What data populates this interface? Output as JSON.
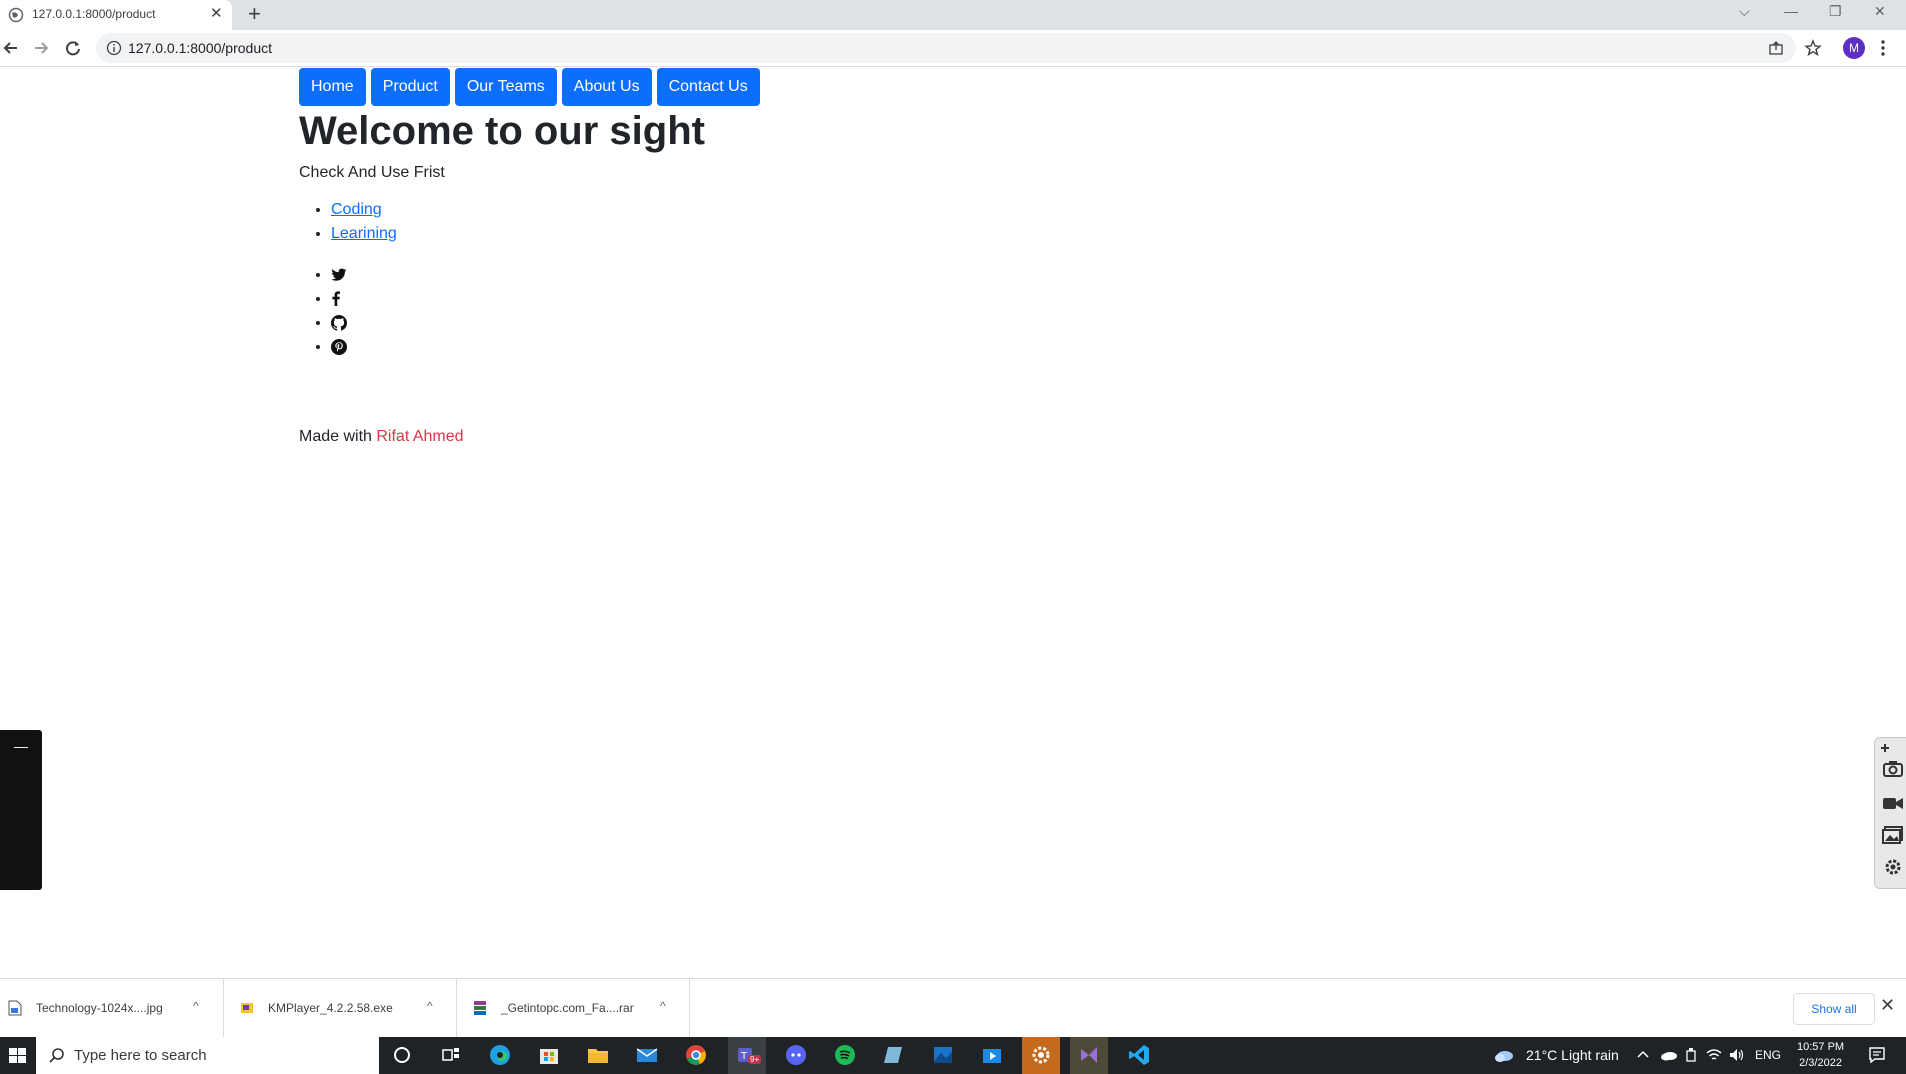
{
  "browser": {
    "tab_title": "127.0.0.1:8000/product",
    "tab_close": "✕",
    "new_tab": "+",
    "url": "127.0.0.1:8000/product",
    "profile_initial": "M",
    "window_controls": {
      "dropdown": "⌵",
      "minimize": "—",
      "restore": "❐",
      "close": "✕"
    }
  },
  "page": {
    "nav": [
      "Home",
      "Product",
      "Our Teams",
      "About Us",
      "Contact Us"
    ],
    "title": "Welcome to our sight",
    "subtitle": "Check And Use Frist",
    "links": [
      "Coding",
      "Learining"
    ],
    "social_icons": [
      "twitter-icon",
      "facebook-icon",
      "github-icon",
      "pinterest-icon"
    ],
    "footer_prefix": "Made with ",
    "footer_author": "Rifat Ahmed",
    "sidebar_min": "—"
  },
  "colors": {
    "primary": "#0d6efd",
    "author": "#dc3545",
    "taskbar": "#1f2326"
  },
  "downloads": {
    "items": [
      "Technology-1024x....jpg",
      "KMPlayer_4.2.2.58.exe",
      "_Getintopc.com_Fa....rar"
    ],
    "caret": "^",
    "show_all": "Show all",
    "close": "✕"
  },
  "taskbar": {
    "search_placeholder": "Type here to search",
    "weather": "21°C  Light rain",
    "lang": "ENG",
    "time": "10:57 PM",
    "date": "2/3/2022",
    "teams_badge": "9+"
  }
}
